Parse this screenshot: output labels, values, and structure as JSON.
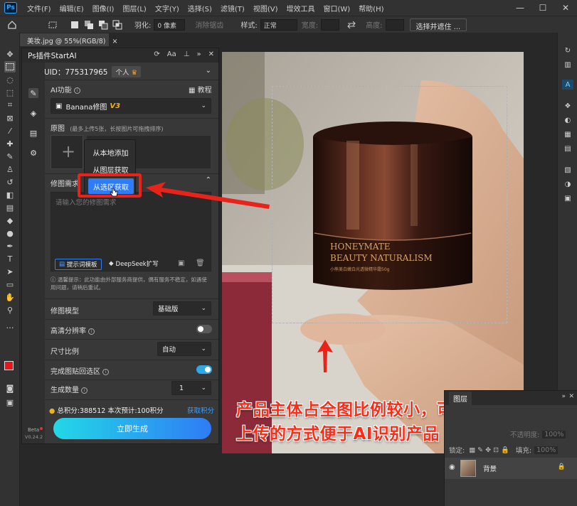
{
  "menubar": {
    "logo": "Ps",
    "items": [
      "文件(F)",
      "编辑(E)",
      "图像(I)",
      "图层(L)",
      "文字(Y)",
      "选择(S)",
      "滤镜(T)",
      "视图(V)",
      "增效工具",
      "窗口(W)",
      "帮助(H)"
    ]
  },
  "optbar": {
    "feather_label": "羽化:",
    "feather_value": "0 像素",
    "antialias_label": "消除锯齿",
    "style_label": "样式:",
    "style_value": "正常",
    "width_label": "宽度:",
    "height_label": "高度:",
    "select_mask_button": "选择并遮住 ..."
  },
  "document": {
    "tab_label": "美妆.jpg @ 55%(RGB/8)"
  },
  "plugin": {
    "title": "Ps插件StartAI",
    "uid": "UID：775317965",
    "account_type": "个人",
    "ai_function_label": "AI功能",
    "tutorial_label": "教程",
    "model_selected": "Banana修图",
    "model_version": "V3",
    "original_label": "原图",
    "original_hint": "(最多上传5张，长按图片可拖拽排序)",
    "upload_plus": "+",
    "popup": {
      "items": [
        "从本地添加",
        "从图层获取",
        "从选区获取"
      ],
      "highlighted": "从选区获取"
    },
    "requirement_label": "修图需求",
    "requirement_placeholder": "请输入您的修图需求",
    "prompt_template_button": "提示词模板",
    "deepseek_button": "DeepSeek扩写",
    "notice": "温馨提示：此功能由外部服务商提供，偶有服务不稳定，如遇使用问题，请稍后重试。",
    "retouch_model_label": "修图模型",
    "retouch_model_value": "基础版",
    "hd_label": "高清分辨率",
    "ratio_label": "尺寸比例",
    "ratio_value": "自动",
    "paste_back_label": "完成图贴回选区",
    "count_label": "生成数量",
    "count_value": "1",
    "points_text": "总积分:388512  本次预计:100积分",
    "get_points_link": "获取积分",
    "generate_button": "立即生成",
    "beta_label": "Beta",
    "version_label": "V0.24.2",
    "hd_enabled": false,
    "paste_back_enabled": true
  },
  "annotation": {
    "line1": "产品主体占全图比例较小，可使用选区",
    "line2": "上传的方式便于AI识别产品",
    "color": "#ff2b17"
  },
  "product": {
    "line1": "HONEYMATE",
    "line2": "BEAUTY NATURALISM",
    "line3": "小熊美白嫩白光透微精华霜50g"
  },
  "layers": {
    "tab_label": "图层",
    "opacity_label": "不透明度:",
    "opacity_value": "100%",
    "lock_label": "锁定:",
    "fill_label": "填充:",
    "fill_value": "100%",
    "background_layer": "背景"
  },
  "colors": {
    "accent_blue": "#2f7cf6",
    "points_link": "#3aa0ff",
    "highlight_red": "#e8231a",
    "foreground_swatch": "#e8151b",
    "background_swatch": "#ffffff"
  }
}
